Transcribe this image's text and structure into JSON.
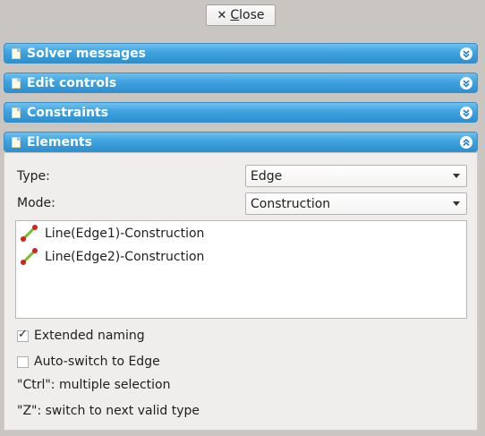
{
  "close_button": {
    "label": "Close",
    "mnemonic": "C",
    "rest": "lose"
  },
  "panels": [
    {
      "title": "Solver messages"
    },
    {
      "title": "Edit controls"
    },
    {
      "title": "Constraints"
    },
    {
      "title": "Elements"
    }
  ],
  "elements": {
    "type_label": "Type:",
    "type_value": "Edge",
    "mode_label": "Mode:",
    "mode_value": "Construction",
    "items": [
      {
        "label": "Line(Edge1)-Construction"
      },
      {
        "label": "Line(Edge2)-Construction"
      }
    ],
    "extended_naming": {
      "label": "Extended naming",
      "checked": true
    },
    "auto_switch": {
      "label": "Auto-switch to Edge",
      "checked": false
    },
    "hint_ctrl": "\"Ctrl\": multiple selection",
    "hint_z": "\"Z\": switch to next valid type"
  }
}
